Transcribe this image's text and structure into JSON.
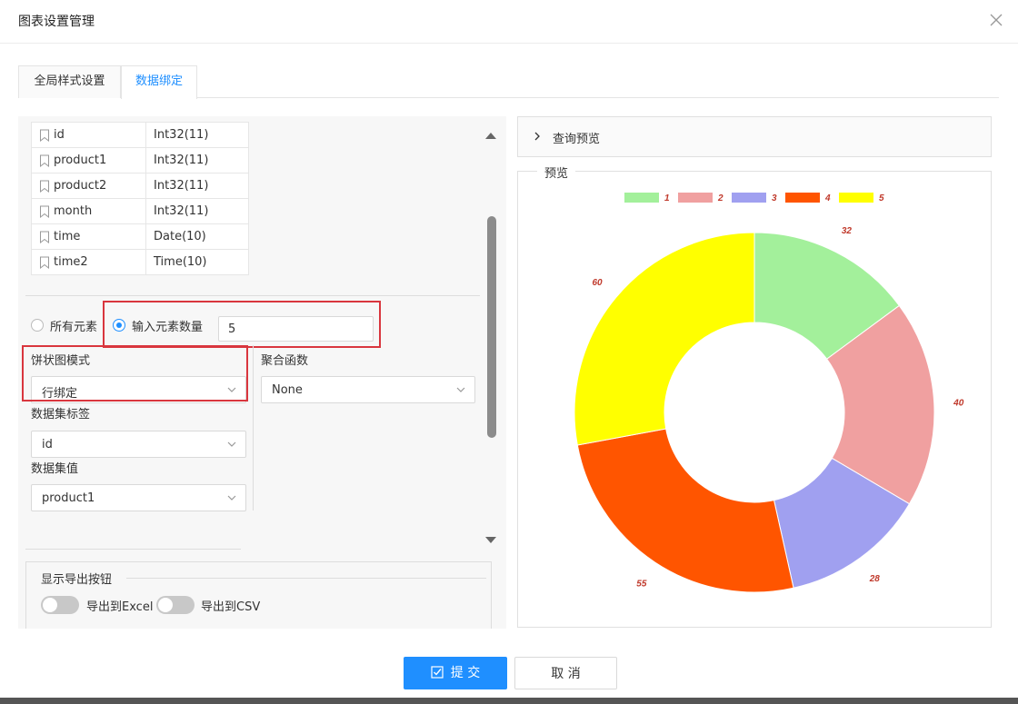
{
  "dialog": {
    "title": "图表设置管理",
    "close_icon": "close-icon"
  },
  "tabs": [
    {
      "label": "全局样式设置",
      "active": false
    },
    {
      "label": "数据绑定",
      "active": true
    }
  ],
  "fields": [
    {
      "name": "id",
      "type": "Int32(11)"
    },
    {
      "name": "product1",
      "type": "Int32(11)"
    },
    {
      "name": "product2",
      "type": "Int32(11)"
    },
    {
      "name": "month",
      "type": "Int32(11)"
    },
    {
      "name": "time",
      "type": "Date(10)"
    },
    {
      "name": "time2",
      "type": "Time(10)"
    }
  ],
  "element_mode": {
    "all_label": "所有元素",
    "count_label": "输入元素数量",
    "selected": "count",
    "count_value": "5"
  },
  "pie_mode": {
    "label": "饼状图模式",
    "value": "行绑定"
  },
  "aggregate": {
    "label": "聚合函数",
    "value": "None"
  },
  "dataset_label": {
    "label": "数据集标签",
    "value": "id"
  },
  "dataset_value": {
    "label": "数据集值",
    "value": "product1"
  },
  "export": {
    "legend": "显示导出按钮",
    "excel_label": "导出到Excel",
    "csv_label": "导出到CSV",
    "excel_on": false,
    "csv_on": false
  },
  "query_preview": {
    "label": "查询预览"
  },
  "preview": {
    "label": "预览"
  },
  "chart_data": {
    "type": "pie",
    "donut": true,
    "categories": [
      "1",
      "2",
      "3",
      "4",
      "5"
    ],
    "values": [
      32,
      40,
      28,
      55,
      60
    ],
    "colors": [
      "#a3f09b",
      "#f0a0a0",
      "#a0a0f0",
      "#ff5500",
      "#ffff00"
    ],
    "legend_position": "top-center",
    "label_color": "#c0392b"
  },
  "footer": {
    "submit_label": "提 交",
    "cancel_label": "取 消"
  },
  "colors": {
    "accent": "#1f8fff",
    "highlight": "#d9363e"
  }
}
